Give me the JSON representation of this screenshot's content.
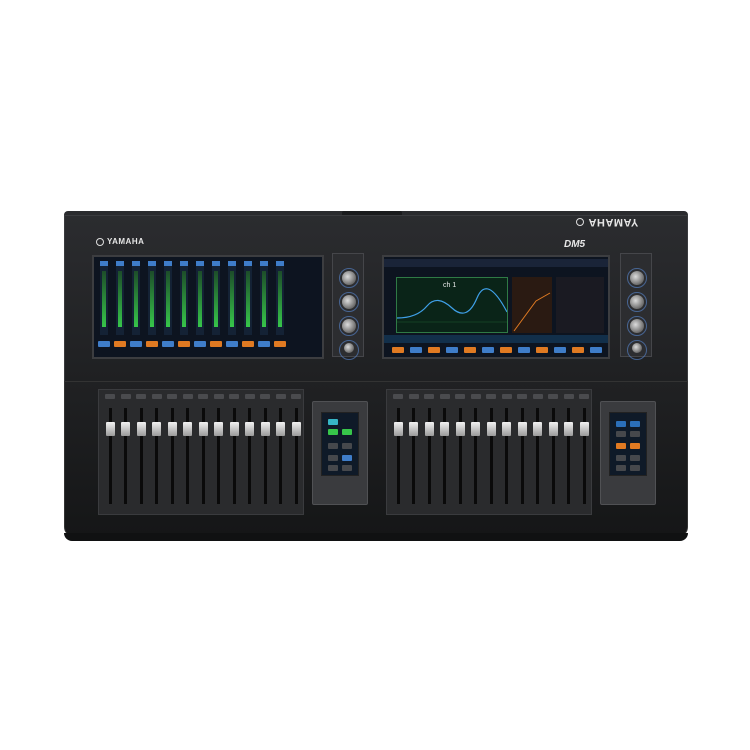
{
  "console": {
    "brand_left": "YAMAHA",
    "brand_back": "YAMAHA",
    "model": "DM5",
    "display_channel": "ch 1",
    "colors": {
      "body": "#222326",
      "screen": "#0d1420",
      "accent_blue": "#3f7dc9",
      "accent_orange": "#e07a22",
      "accent_green": "#37c64a",
      "accent_cyan": "#37b6c6"
    },
    "left_screen_strip_count": 12,
    "right_screen_strip_count": 12,
    "left_fader_count": 13,
    "right_fader_count": 13,
    "icons": [
      "yamaha-logo-icon",
      "rotary-knob-icon",
      "fader-cap-icon"
    ]
  }
}
